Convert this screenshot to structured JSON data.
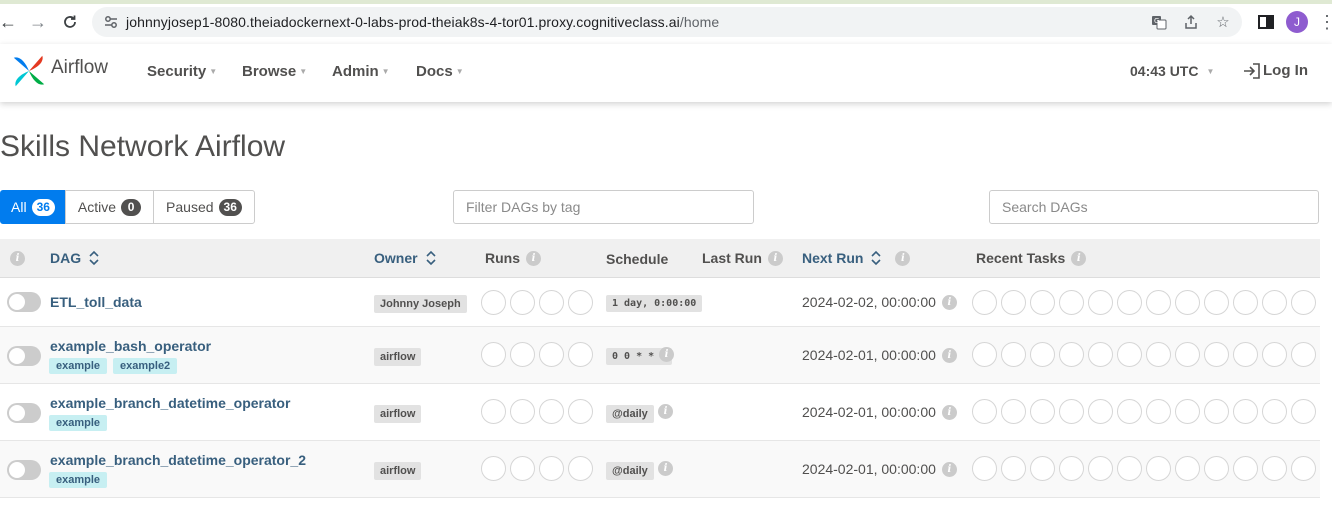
{
  "browser": {
    "url_host": "johnnyjosep1-8080.theiadockernext-0-labs-prod-theiak8s-4-tor01.proxy.cognitiveclass.ai",
    "url_path": "/home",
    "profile_initial": "J"
  },
  "navbar": {
    "brand": "Airflow",
    "menus": [
      "Security",
      "Browse",
      "Admin",
      "Docs"
    ],
    "time": "04:43 UTC",
    "login": "Log In"
  },
  "page": {
    "title": "Skills Network Airflow"
  },
  "status_tabs": [
    {
      "label": "All",
      "count": "36"
    },
    {
      "label": "Active",
      "count": "0"
    },
    {
      "label": "Paused",
      "count": "36"
    }
  ],
  "filters": {
    "tag_placeholder": "Filter DAGs by tag",
    "search_placeholder": "Search DAGs"
  },
  "table": {
    "headers": {
      "dag": "DAG",
      "owner": "Owner",
      "runs": "Runs",
      "schedule": "Schedule",
      "last_run": "Last Run",
      "next_run": "Next Run",
      "recent_tasks": "Recent Tasks"
    },
    "rows": [
      {
        "dag_id": "ETL_toll_data",
        "tags": [],
        "owner": "Johnny Joseph",
        "schedule": "1 day, 0:00:00",
        "next_run": "2024-02-02, 00:00:00"
      },
      {
        "dag_id": "example_bash_operator",
        "tags": [
          "example",
          "example2"
        ],
        "owner": "airflow",
        "schedule": "0 0 * * *",
        "next_run": "2024-02-01, 00:00:00"
      },
      {
        "dag_id": "example_branch_datetime_operator",
        "tags": [
          "example"
        ],
        "owner": "airflow",
        "schedule": "@daily",
        "next_run": "2024-02-01, 00:00:00"
      },
      {
        "dag_id": "example_branch_datetime_operator_2",
        "tags": [
          "example"
        ],
        "owner": "airflow",
        "schedule": "@daily",
        "next_run": "2024-02-01, 00:00:00"
      }
    ]
  },
  "colors": {
    "accent": "#017cee",
    "link": "#385f7e",
    "tag_bg": "#c7eff2"
  }
}
